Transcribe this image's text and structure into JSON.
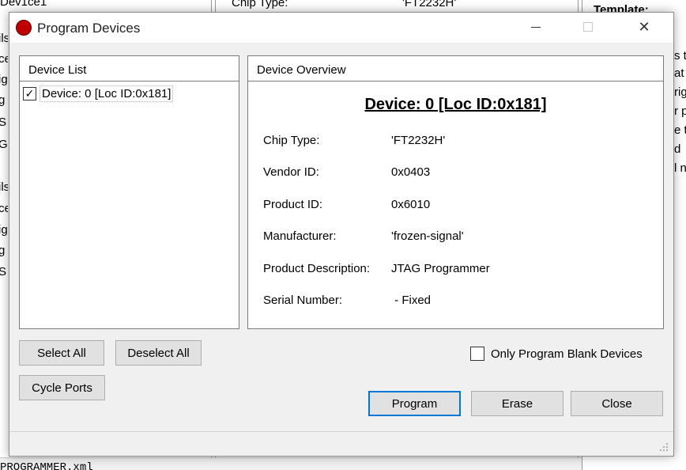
{
  "background": {
    "top_mid_label": "Chip Type:",
    "top_mid_value": "'FT2232H'",
    "top_right_label": "Template:",
    "top_left_label": "Dev1ce1",
    "bottom_left_label": "PROGRAMMER.xml",
    "left_fragments": [
      "ils",
      "ce",
      "ig",
      "g",
      "S",
      "G",
      "ils",
      "ce",
      "ig",
      "g",
      "S"
    ],
    "right_fragments": [
      "s t",
      "at",
      "rig",
      "r p",
      "e t",
      "d",
      "l n"
    ]
  },
  "dialog": {
    "title": "Program Devices",
    "icon": "red-circle-icon",
    "window_controls": {
      "minimize": "minimize-icon",
      "maximize": "maximize-icon",
      "close": "✕"
    },
    "device_list": {
      "title": "Device List",
      "items": [
        {
          "label": "Device: 0 [Loc ID:0x181]",
          "checked": true,
          "check_glyph": "✓"
        }
      ]
    },
    "device_overview": {
      "title": "Device Overview",
      "heading": "Device: 0 [Loc ID:0x181]",
      "rows": [
        {
          "label": "Chip Type:",
          "value": "'FT2232H'"
        },
        {
          "label": "Vendor ID:",
          "value": "0x0403"
        },
        {
          "label": "Product ID:",
          "value": "0x6010"
        },
        {
          "label": "Manufacturer:",
          "value": "'frozen-signal'"
        },
        {
          "label": "Product Description:",
          "value": "JTAG Programmer"
        },
        {
          "label": "Serial Number:",
          "value": " - Fixed"
        }
      ]
    },
    "buttons": {
      "select_all": "Select All",
      "deselect_all": "Deselect All",
      "cycle_ports": "Cycle Ports",
      "program": "Program",
      "erase": "Erase",
      "close": "Close"
    },
    "only_blank": {
      "label": "Only Program Blank Devices",
      "checked": false
    },
    "accent_color": "#0078d7"
  }
}
